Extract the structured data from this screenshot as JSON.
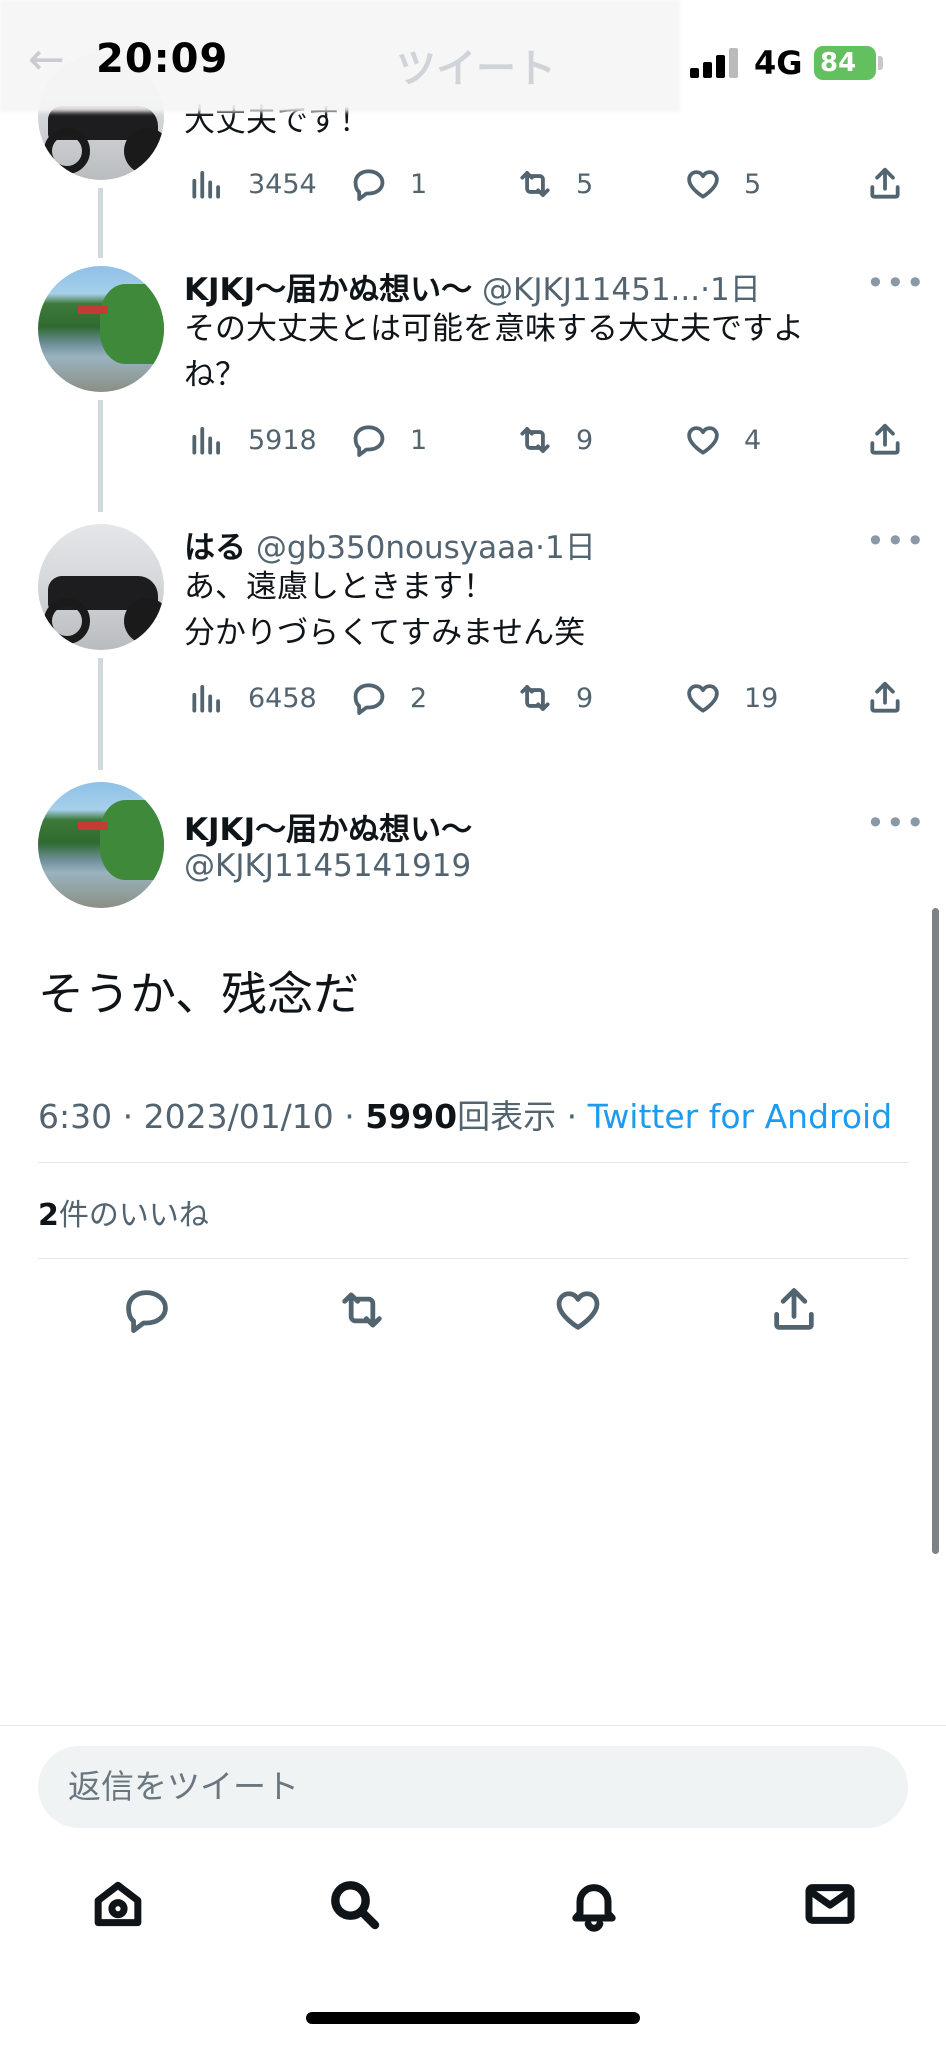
{
  "status_bar": {
    "time": "20:09",
    "network": "4G",
    "battery": "84",
    "ghost_title": "ツイート",
    "ghost_back": "←"
  },
  "thread": [
    {
      "text_partial": "大丈夫です！",
      "stats": {
        "views": "3454",
        "replies": "1",
        "retweets": "5",
        "likes": "5"
      }
    },
    {
      "name": "KJKJ〜届かぬ想い〜",
      "handle": "@KJKJ11451...",
      "separator": "·",
      "time_ago": "1日",
      "text_line1": "その大丈夫とは可能を意味する大丈夫ですよ",
      "text_line2": "ね？",
      "stats": {
        "views": "5918",
        "replies": "1",
        "retweets": "9",
        "likes": "4"
      }
    },
    {
      "name": "はる",
      "handle": "@gb350nousyaaa",
      "separator": "·",
      "time_ago": "1日",
      "text_line1": "あ、遠慮しときます！",
      "text_line2": "分かりづらくてすみません笑",
      "stats": {
        "views": "6458",
        "replies": "2",
        "retweets": "9",
        "likes": "19"
      }
    }
  ],
  "main_tweet": {
    "name": "KJKJ〜届かぬ想い〜",
    "handle": "@KJKJ1145141919",
    "text": "そうか、残念だ",
    "time": "6:30",
    "date": "2023/01/10",
    "view_count": "5990",
    "view_label": "回表示",
    "via": "Twitter for Android",
    "sep": " · ",
    "likes_count": "2",
    "likes_label": "件のいいね"
  },
  "reply_box": {
    "placeholder": "返信をツイート"
  },
  "more_glyph": "•••",
  "icons": [
    "views-icon",
    "reply-icon",
    "retweet-icon",
    "like-icon",
    "share-icon",
    "home-icon",
    "search-icon",
    "notifications-icon",
    "messages-icon"
  ],
  "colors": {
    "link": "#1d9bf0",
    "secondary_text": "#536471",
    "battery": "#62c15e"
  }
}
